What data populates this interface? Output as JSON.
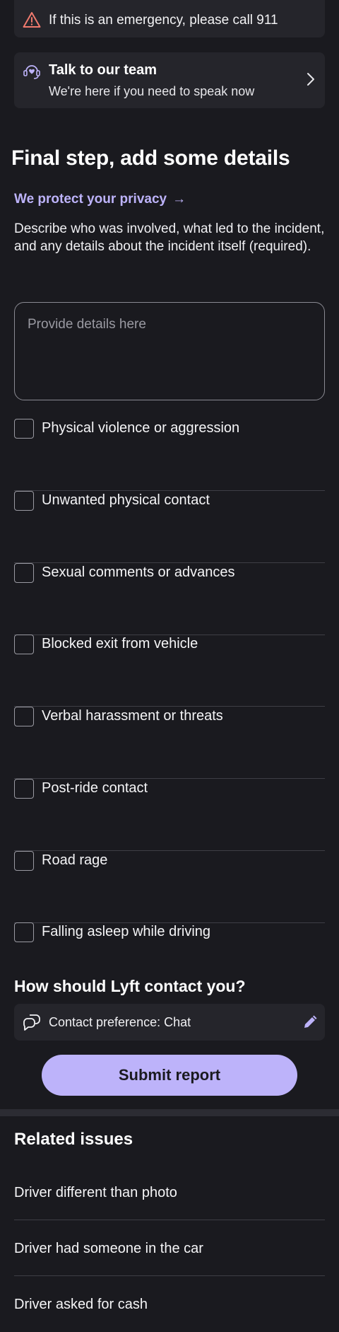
{
  "emergency": {
    "text": "If this is an emergency, please call 911"
  },
  "talk": {
    "title": "Talk to our team",
    "subtitle": "We're here if you need to speak now"
  },
  "form": {
    "heading": "Final step, add some details",
    "privacy_link": "We protect your privacy",
    "description": "Describe who was involved, what led to the incident, and any details about the incident itself (required).",
    "details_value": "",
    "details_placeholder": "Provide details here",
    "options": [
      {
        "label": "Physical violence or aggression",
        "checked": false
      },
      {
        "label": "Unwanted physical contact",
        "checked": false
      },
      {
        "label": "Sexual comments or advances",
        "checked": false
      },
      {
        "label": "Blocked exit from vehicle",
        "checked": false
      },
      {
        "label": "Verbal harassment or threats",
        "checked": false
      },
      {
        "label": "Post-ride contact",
        "checked": false
      },
      {
        "label": "Road rage",
        "checked": false
      },
      {
        "label": "Falling asleep while driving",
        "checked": false
      }
    ]
  },
  "contact": {
    "heading": "How should Lyft contact you?",
    "preference": "Contact preference: Chat"
  },
  "submit_label": "Submit report",
  "related": {
    "heading": "Related issues",
    "items": [
      "Driver different than photo",
      "Driver had someone in the car",
      "Driver asked for cash"
    ]
  },
  "colors": {
    "background": "#1a1a1f",
    "card": "#25252b",
    "accent": "#bdb3fa",
    "warning": "#f07a6e"
  }
}
